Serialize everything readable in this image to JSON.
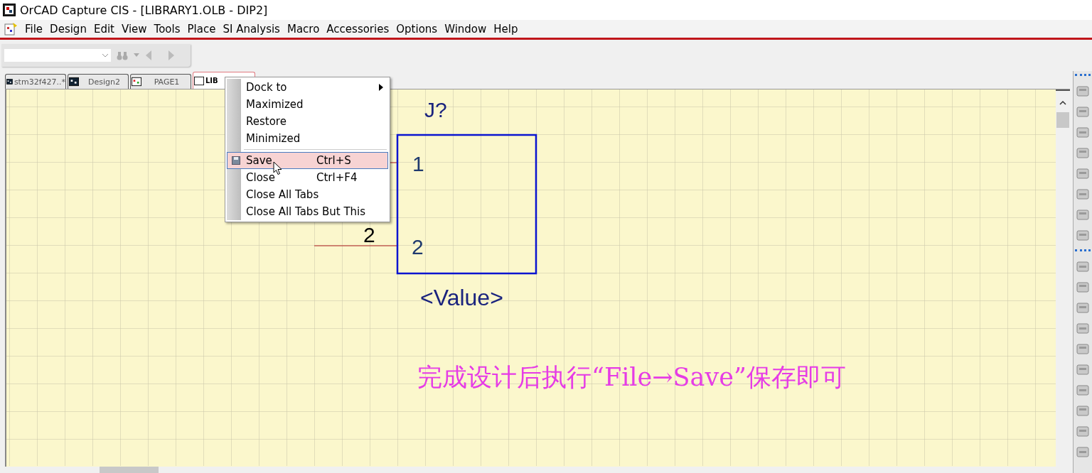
{
  "window": {
    "title": "OrCAD Capture CIS - [LIBRARY1.OLB - DIP2]"
  },
  "menu_bar": [
    "File",
    "Design",
    "Edit",
    "View",
    "Tools",
    "Place",
    "SI Analysis",
    "Macro",
    "Accessories",
    "Options",
    "Window",
    "Help"
  ],
  "tabs": [
    {
      "label": "stm32f427..*",
      "selected": false
    },
    {
      "label": "Design2",
      "selected": false
    },
    {
      "label": "PAGE1",
      "selected": false
    },
    {
      "label": "LIB",
      "selected": true
    }
  ],
  "schematic": {
    "reference": "J?",
    "value": "<Value>",
    "pin_numbers_inside": [
      "1",
      "2"
    ],
    "pin_label_outside": "2"
  },
  "context_menu": [
    {
      "kind": "item",
      "label": "Dock to",
      "submenu": true,
      "highlighted": false,
      "has_icon": false
    },
    {
      "kind": "item",
      "label": "Maximized",
      "submenu": false,
      "highlighted": false,
      "has_icon": false
    },
    {
      "kind": "item",
      "label": "Restore",
      "submenu": false,
      "highlighted": false,
      "has_icon": false
    },
    {
      "kind": "item",
      "label": "Minimized",
      "submenu": false,
      "highlighted": false,
      "has_icon": false
    },
    {
      "kind": "separator"
    },
    {
      "kind": "item",
      "label": "Save",
      "shortcut": "Ctrl+S",
      "submenu": false,
      "highlighted": true,
      "has_icon": true
    },
    {
      "kind": "item",
      "label": "Close",
      "shortcut": "Ctrl+F4",
      "submenu": false,
      "highlighted": false,
      "has_icon": false
    },
    {
      "kind": "item",
      "label": "Close All Tabs",
      "submenu": false,
      "highlighted": false,
      "has_icon": false
    },
    {
      "kind": "item",
      "label": "Close All Tabs But This",
      "submenu": false,
      "highlighted": false,
      "has_icon": false
    }
  ],
  "annotation": "完成设计后执行“File→Save”保存即可"
}
